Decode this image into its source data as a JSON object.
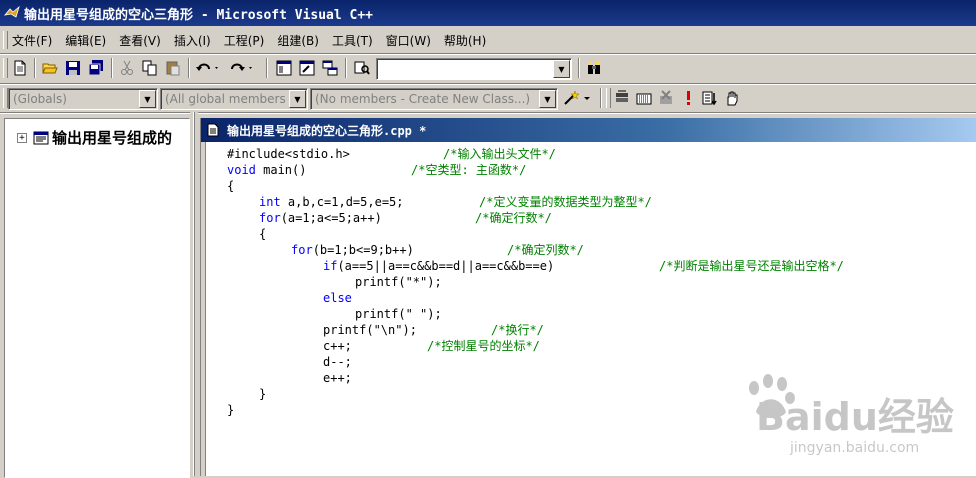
{
  "window": {
    "title": "输出用星号组成的空心三角形 - Microsoft Visual C++"
  },
  "menu": [
    "文件(F)",
    "编辑(E)",
    "查看(V)",
    "插入(I)",
    "工程(P)",
    "组建(B)",
    "工具(T)",
    "窗口(W)",
    "帮助(H)"
  ],
  "toolbar": {
    "find_value": ""
  },
  "wizardbar": {
    "classes": "(Globals)",
    "filter": "(All global members",
    "members": "(No members - Create New Class...)"
  },
  "workspace": {
    "tree_root": "输出用星号组成的"
  },
  "editor": {
    "tab_title": "输出用星号组成的空心三角形.cpp *",
    "lines": [
      {
        "code": "#include<stdio.h>",
        "keyword": "",
        "comment": "/*输入输出头文件*/"
      },
      {
        "code": " main()",
        "keyword": "void",
        "comment": "/*空类型: 主函数*/"
      },
      {
        "code": "{",
        "keyword": "",
        "comment": ""
      },
      {
        "code": " a,b,c=1,d=5,e=5;",
        "keyword": "int",
        "comment": "/*定义变量的数据类型为整型*/"
      },
      {
        "code": "(a=1;a<=5;a++)",
        "keyword": "for",
        "comment": "/*确定行数*/"
      },
      {
        "code": "{",
        "keyword": "",
        "comment": ""
      },
      {
        "code": "(b=1;b<=9;b++)",
        "keyword": "for",
        "comment": "/*确定列数*/"
      },
      {
        "code": "(a==5||a==c&&b==d||a==c&&b==e)",
        "keyword": "if",
        "comment": "/*判断是输出星号还是输出空格*/"
      },
      {
        "code": "printf(\"*\");",
        "keyword": "",
        "comment": ""
      },
      {
        "code": "",
        "keyword": "else",
        "comment": ""
      },
      {
        "code": "printf(\" \");",
        "keyword": "",
        "comment": ""
      },
      {
        "code": "printf(\"\\n\");",
        "keyword": "",
        "comment": "/*换行*/"
      },
      {
        "code": "c++;",
        "keyword": "",
        "comment": "/*控制星号的坐标*/"
      },
      {
        "code": "d--;",
        "keyword": "",
        "comment": ""
      },
      {
        "code": "e++;",
        "keyword": "",
        "comment": ""
      },
      {
        "code": "}",
        "keyword": "",
        "comment": ""
      },
      {
        "code": "}",
        "keyword": "",
        "comment": ""
      }
    ]
  },
  "watermark": {
    "brand": "Baidu经验",
    "url": "jingyan.baidu.com"
  }
}
